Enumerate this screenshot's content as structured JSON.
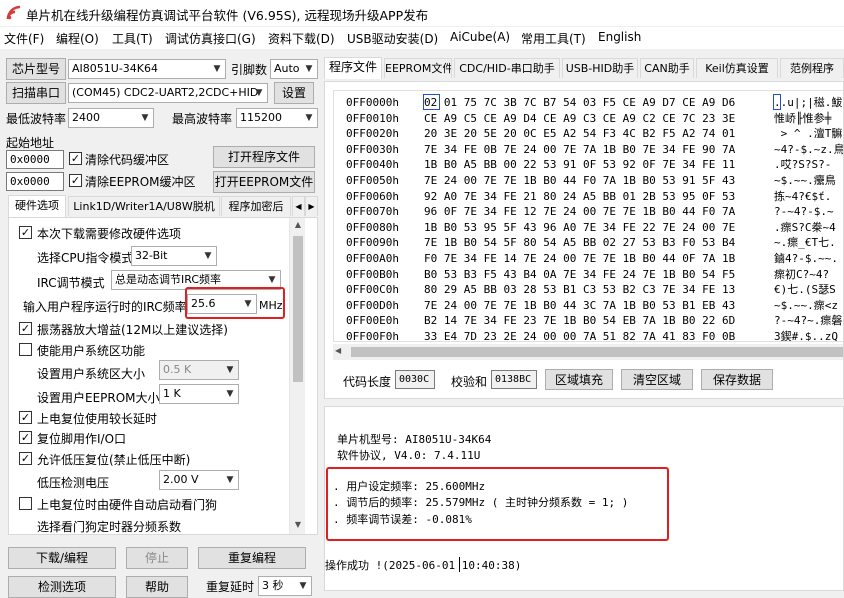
{
  "window": {
    "title": "单片机在线升级编程仿真调试平台软件 (V6.95S), 远程现场升级APP发布"
  },
  "menu": [
    {
      "label": "文件(F)"
    },
    {
      "label": "编程(O)"
    },
    {
      "label": "工具(T)"
    },
    {
      "label": "调试仿真接口(G)"
    },
    {
      "label": "资料下载(D)"
    },
    {
      "label": "USB驱动安装(D)"
    },
    {
      "label": "AiCube(A)"
    },
    {
      "label": "常用工具(T)"
    },
    {
      "label": "English"
    }
  ],
  "left": {
    "chip_label": "芯片型号",
    "chip_value": "AI8051U-34K64",
    "pins_label": "引脚数",
    "pins_value": "Auto",
    "scan_button": "扫描串口",
    "port_value": "(COM45) CDC2-UART2,2CDC+HID",
    "settings_button": "设置",
    "min_baud_label": "最低波特率",
    "min_baud_value": "2400",
    "max_baud_label": "最高波特率",
    "max_baud_value": "115200",
    "start_addr_label": "起始地址",
    "addr1": "0x0000",
    "clear_code_label": "清除代码缓冲区",
    "open_prog_button": "打开程序文件",
    "addr2": "0x0000",
    "clear_eeprom_label": "清除EEPROM缓冲区",
    "open_eeprom_button": "打开EEPROM文件",
    "tabs": [
      "硬件选项",
      "Link1D/Writer1A/U8W脱机",
      "程序加密后"
    ],
    "options": {
      "opt1": "本次下载需要修改硬件选项",
      "cpu_mode_label": "选择CPU指令模式",
      "cpu_mode_value": "32-Bit",
      "irc_mode_label": "IRC调节模式",
      "irc_mode_value": "总是动态调节IRC频率",
      "freq_label": "输入用户程序运行时的IRC频率",
      "freq_value": "25.6",
      "freq_unit": "MHz",
      "osc_label": "振荡器放大增益(12M以上建议选择)",
      "sys_area_label": "使能用户系统区功能",
      "sys_size_label": "设置用户系统区大小",
      "sys_size_value": "0.5 K",
      "eeprom_size_label": "设置用户EEPROM大小",
      "eeprom_size_value": "1   K",
      "power_delay_label": "上电复位使用较长延时",
      "reset_pin_label": "复位脚用作I/O口",
      "lvr_label": "允许低压复位(禁止低压中断)",
      "lvd_label": "低压检测电压",
      "lvd_value": "2.00 V",
      "wdt_label": "上电复位时由硬件自动启动看门狗",
      "wdt_div_label": "选择看门狗定时器分频系数"
    },
    "download_button": "下载/编程",
    "stop_button": "停止",
    "reprogram_button": "重复编程",
    "check_button": "检测选项",
    "help_button": "帮助",
    "repeat_delay_label": "重复延时",
    "repeat_delay_value": "3 秒"
  },
  "right": {
    "tabs": [
      "程序文件",
      "EEPROM文件",
      "CDC/HID-串口助手",
      "USB-HID助手",
      "CAN助手",
      "Keil仿真设置",
      "范例程序"
    ],
    "hex_rows": [
      {
        "addr": "0FF0000h",
        "bytes": "02 01 75 7C 3B 7C B7 54 03 F5 CE A9 D7 CE A9 D6",
        "ascii": "..u|;|稵.鮁"
      },
      {
        "addr": "0FF0010h",
        "bytes": "CE A9 C5 CE A9 D4 CE A9 C3 CE A9 C2 CE 7C 23 3E",
        "ascii": "惟峤╟惟参╪"
      },
      {
        "addr": "0FF0020h",
        "bytes": "20 3E 20 5E 20 0C E5 A2 54 F3 4C B2 F5 A2 74 01",
        "ascii": " > ^ .澶T髍"
      },
      {
        "addr": "0FF0030h",
        "bytes": "7E 34 FE 0B 7E 24 00 7E 7A 1B B0 7E 34 FE 90 7A",
        "ascii": "~4?-$.~z.鳥"
      },
      {
        "addr": "0FF0040h",
        "bytes": "1B B0 A5 BB 00 22 53 91 0F 53 92 0F 7E 34 FE 11",
        "ascii": ".哎?S?S?-"
      },
      {
        "addr": "0FF0050h",
        "bytes": "7E 24 00 7E 7E 1B B0 44 F0 7A 1B B0 53 91 5F 43",
        "ascii": "~$.~~.癳鳥"
      },
      {
        "addr": "0FF0060h",
        "bytes": "92 A0 7E 34 FE 21 80 24 A5 BB 01 2B 53 95 0F 53",
        "ascii": "拣~4?€$ť."
      },
      {
        "addr": "0FF0070h",
        "bytes": "96 0F 7E 34 FE 12 7E 24 00 7E 7E 1B B0 44 F0 7A",
        "ascii": "?-~4?-$.~"
      },
      {
        "addr": "0FF0080h",
        "bytes": "1B B0 53 95 5F 43 96 A0 7E 34 FE 22 7E 24 00 7E",
        "ascii": ".瘝S?C桊~4"
      },
      {
        "addr": "0FF0090h",
        "bytes": "7E 1B B0 54 5F 80 54 A5 BB 02 27 53 B3 F0 53 B4",
        "ascii": "~.瘝_€T七."
      },
      {
        "addr": "0FF00A0h",
        "bytes": "F0 7E 34 FE 14 7E 24 00 7E 7E 1B B0 44 0F 7A 1B",
        "ascii": "鏀4?-$.~~."
      },
      {
        "addr": "0FF00B0h",
        "bytes": "B0 53 B3 F5 43 B4 0A 7E 34 FE 24 7E 1B B0 54 F5",
        "ascii": "瘝初C?~4?"
      },
      {
        "addr": "0FF00C0h",
        "bytes": "80 29 A5 BB 03 28 53 B1 C3 53 B2 C3 7E 34 FE 13",
        "ascii": "€)七.(S瑟S"
      },
      {
        "addr": "0FF00D0h",
        "bytes": "7E 24 00 7E 7E 1B B0 44 3C 7A 1B B0 53 B1 EB 43",
        "ascii": "~$.~~.瘝<z"
      },
      {
        "addr": "0FF00E0h",
        "bytes": "B2 14 7E 34 FE 23 7E 1B B0 54 EB 7A 1B B0 22 6D",
        "ascii": "?-~4?~.瘝磐"
      },
      {
        "addr": "0FF00F0h",
        "bytes": "33 E4 7D 23 2E 24 00 00 7A 51 82 7A 41 83 F0 0B",
        "ascii": "3鍥#.$..zQ"
      }
    ],
    "code_len_label": "代码长度",
    "code_len_value": "0030C",
    "checksum_label": "校验和",
    "checksum_value": "0138BC",
    "fill_button": "区域填充",
    "clear_button": "清空区域",
    "save_button": "保存数据",
    "log": {
      "line1": "单片机型号: AI8051U-34K64",
      "line2": "软件协议, V4.0: 7.4.11U",
      "line3": ". 用户设定频率: 25.600MHz",
      "line4": ". 调节后的频率: 25.579MHz ( 主时钟分频系数 = 1; )",
      "line5": ". 频率调节误差: -0.081%",
      "status": "操作成功 !(2025-06-01 10:40:38)"
    }
  }
}
